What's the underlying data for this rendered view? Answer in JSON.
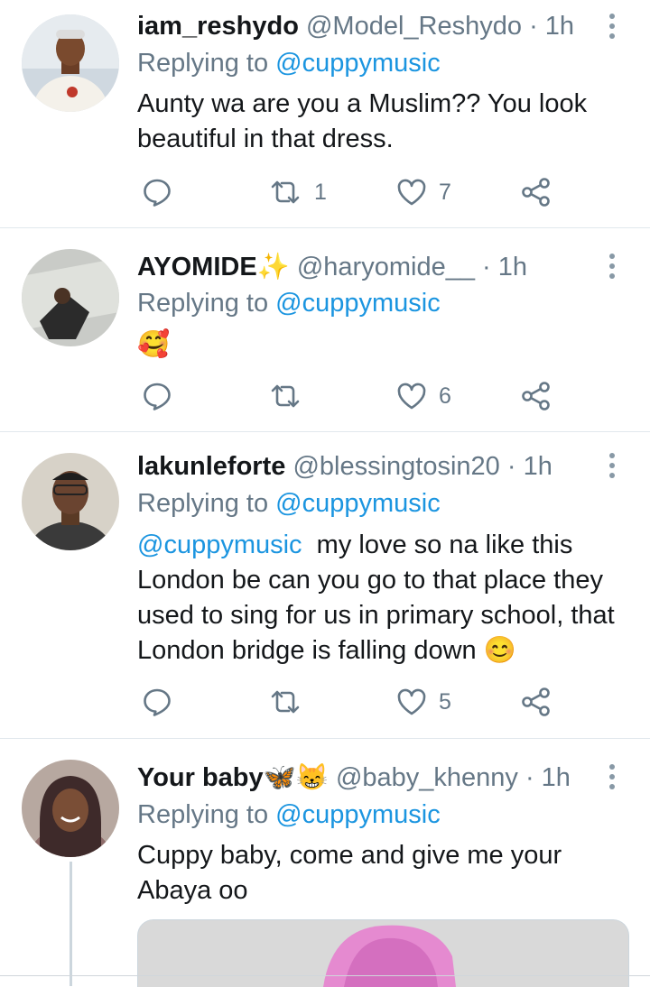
{
  "tweets": [
    {
      "name": "iam_reshydo",
      "name_emoji": "",
      "handle": "@Model_Reshydo",
      "time": "· 1h",
      "replying_prefix": "Replying to ",
      "replying_to": "@cuppymusic",
      "text_mention": "",
      "text": "Aunty wa are you a Muslim?? You look beautiful in that dress.",
      "retweets": "1",
      "likes": "7",
      "replies": ""
    },
    {
      "name": "AYOMIDE",
      "name_emoji": "✨",
      "handle": "@haryomide__",
      "time": "· 1h",
      "replying_prefix": "Replying to ",
      "replying_to": "@cuppymusic",
      "text_mention": "",
      "text": "🥰",
      "retweets": "",
      "likes": "6",
      "replies": ""
    },
    {
      "name": "lakunleforte",
      "name_emoji": "",
      "handle": "@blessingtosin20",
      "time": "· 1h",
      "replying_prefix": "Replying to ",
      "replying_to": "@cuppymusic",
      "text_mention": "@cuppymusic",
      "text": "  my love so na like this London be can you go to that place they used to sing for us in primary school, that London bridge is falling down 😊",
      "retweets": "",
      "likes": "5",
      "replies": ""
    },
    {
      "name": "Your baby",
      "name_emoji": "🦋😸",
      "handle": "@baby_khenny",
      "time": "· 1h",
      "replying_prefix": "Replying to ",
      "replying_to": "@cuppymusic",
      "text_mention": "",
      "text": "Cuppy baby, come and give me your Abaya oo"
    }
  ],
  "icons": {
    "reply": "reply-icon",
    "retweet": "retweet-icon",
    "like": "heart-icon",
    "share": "share-icon",
    "more": "more-vertical-icon"
  },
  "colors": {
    "link": "#1b95e0",
    "secondary_text": "#657786",
    "icon": "#657786",
    "divider": "#e1e8ed"
  }
}
